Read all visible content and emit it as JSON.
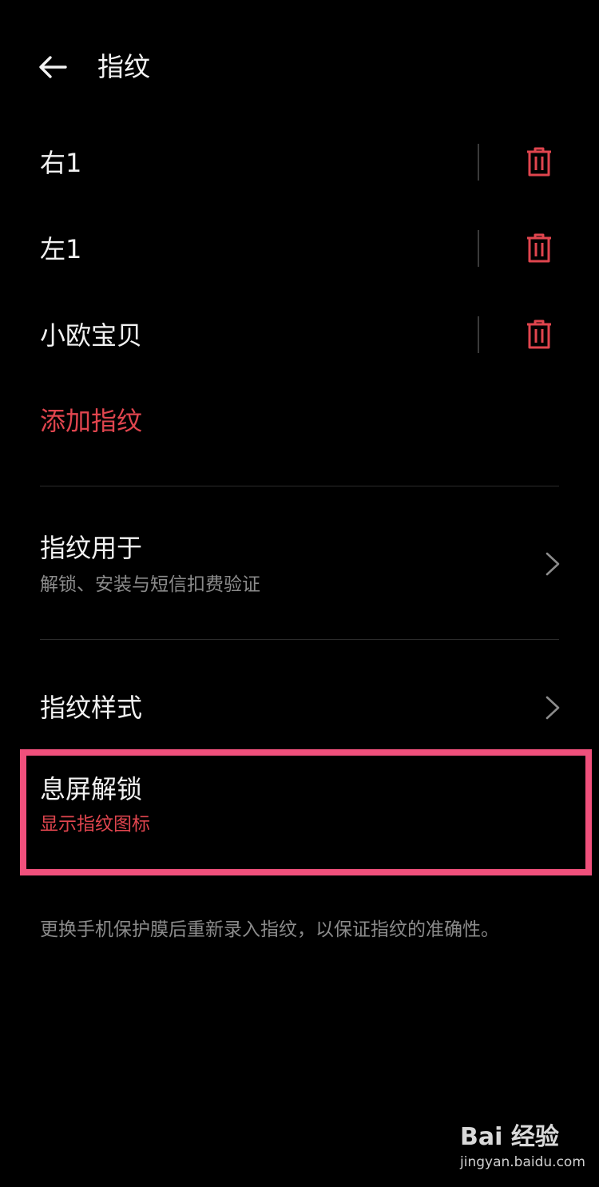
{
  "header": {
    "title": "指纹",
    "back_icon": "arrow-left-icon"
  },
  "fingerprints": [
    {
      "name": "右1",
      "delete_icon": "trash-icon"
    },
    {
      "name": "左1",
      "delete_icon": "trash-icon"
    },
    {
      "name": "小欧宝贝",
      "delete_icon": "trash-icon"
    }
  ],
  "add_fingerprint_label": "添加指纹",
  "settings": {
    "usage": {
      "title": "指纹用于",
      "subtitle": "解锁、安装与短信扣费验证"
    },
    "style": {
      "title": "指纹样式"
    },
    "screen_off_unlock": {
      "title": "息屏解锁",
      "subtitle": "显示指纹图标"
    }
  },
  "footnote": "更换手机保护膜后重新录入指纹，以保证指纹的准确性。",
  "watermark": {
    "logo": "Bai 经验",
    "url": "jingyan.baidu.com"
  },
  "colors": {
    "background": "#000000",
    "accent_red": "#e0454e",
    "highlight_pink": "#f0507c",
    "secondary_text": "#8b8b8b"
  }
}
